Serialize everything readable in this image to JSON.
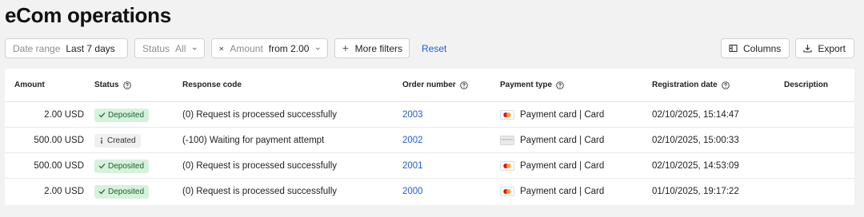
{
  "page": {
    "title": "eCom operations"
  },
  "filters": {
    "date_range": {
      "label": "Date range",
      "value": "Last 7 days"
    },
    "status": {
      "label": "Status",
      "value": "All"
    },
    "amount": {
      "label": "Amount",
      "value": "from 2.00"
    },
    "more_filters": "More filters",
    "reset": "Reset"
  },
  "actions": {
    "columns": "Columns",
    "export": "Export"
  },
  "table": {
    "columns": {
      "amount": "Amount",
      "status": "Status",
      "response_code": "Response code",
      "order_number": "Order number",
      "payment_type": "Payment type",
      "registration_date": "Registration date",
      "description": "Description"
    },
    "rows": [
      {
        "amount": "2.00 USD",
        "status": "Deposited",
        "status_kind": "deposited",
        "response": "(0) Request is processed successfully",
        "order": "2003",
        "payment": "Payment card | Card",
        "card_icon": "mastercard-icon",
        "date": "02/10/2025, 15:14:47",
        "description": ""
      },
      {
        "amount": "500.00 USD",
        "status": "Created",
        "status_kind": "created",
        "response": "(-100) Waiting for payment attempt",
        "order": "2002",
        "payment": "Payment card | Card",
        "card_icon": "generic-card-icon",
        "date": "02/10/2025, 15:00:33",
        "description": ""
      },
      {
        "amount": "500.00 USD",
        "status": "Deposited",
        "status_kind": "deposited",
        "response": "(0) Request is processed successfully",
        "order": "2001",
        "payment": "Payment card | Card",
        "card_icon": "mastercard-icon",
        "date": "02/10/2025, 14:53:09",
        "description": ""
      },
      {
        "amount": "2.00 USD",
        "status": "Deposited",
        "status_kind": "deposited",
        "response": "(0) Request is processed successfully",
        "order": "2000",
        "payment": "Payment card | Card",
        "card_icon": "mastercard-icon",
        "date": "01/10/2025, 19:17:22",
        "description": ""
      }
    ]
  },
  "colors": {
    "link": "#1b5fd1",
    "deposited_bg": "#d6f2dc",
    "created_bg": "#f0f0f1",
    "background": "#f2f2f3"
  }
}
